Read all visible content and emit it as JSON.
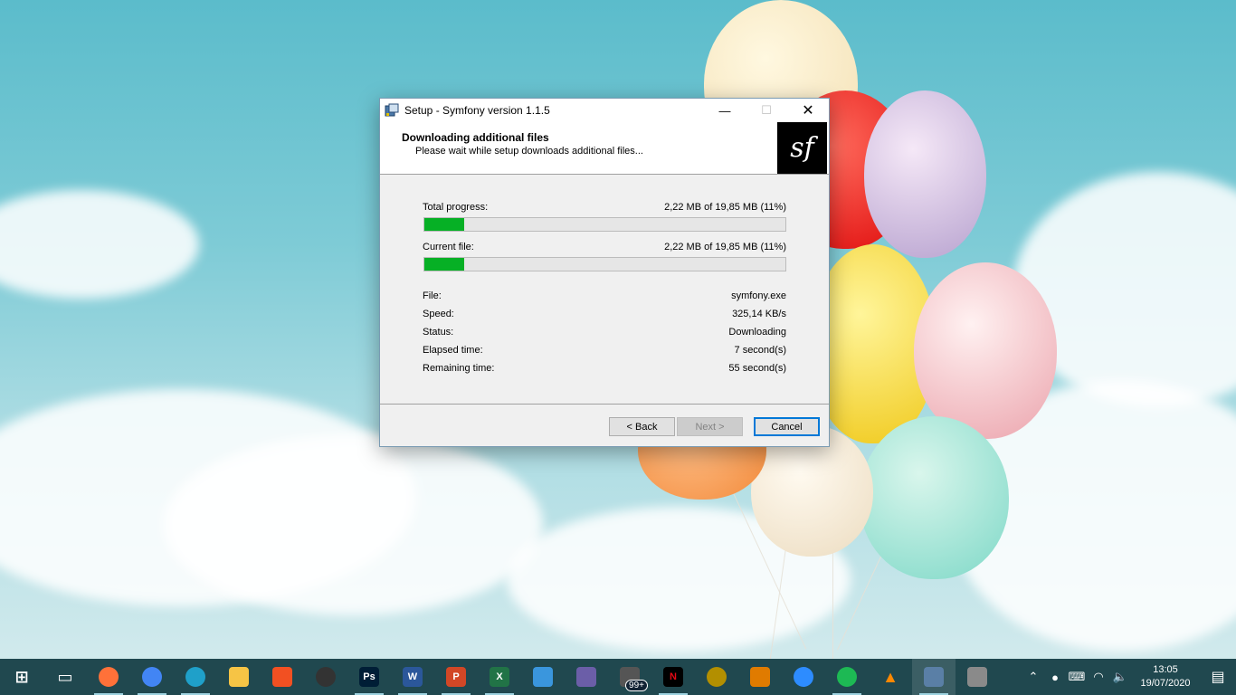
{
  "window": {
    "title": "Setup - Symfony version 1.1.5",
    "minimize_glyph": "—",
    "maximize_glyph": "☐",
    "close_glyph": "✕"
  },
  "header": {
    "title": "Downloading additional files",
    "subtitle": "Please wait while setup downloads additional files...",
    "logo_text": "sf"
  },
  "progress": {
    "total_label": "Total progress:",
    "total_value": "2,22 MB of 19,85 MB (11%)",
    "total_fraction": 0.11,
    "current_label": "Current file:",
    "current_value": "2,22 MB of 19,85 MB (11%)",
    "current_fraction": 0.11
  },
  "details": [
    {
      "label": "File:",
      "value": "symfony.exe"
    },
    {
      "label": "Speed:",
      "value": "325,14 KB/s"
    },
    {
      "label": "Status:",
      "value": "Downloading"
    },
    {
      "label": "Elapsed time:",
      "value": "7 second(s)"
    },
    {
      "label": "Remaining time:",
      "value": "55 second(s)"
    }
  ],
  "buttons": {
    "back": "< Back",
    "next": "Next >",
    "cancel": "Cancel"
  },
  "colors": {
    "progress_fill": "#06b025",
    "taskbar": "#20484f"
  },
  "taskbar": {
    "badge": "99+",
    "items": [
      {
        "name": "start-icon",
        "color": "#ffffff",
        "text": "⊞"
      },
      {
        "name": "task-view-icon",
        "color": "#ffffff",
        "text": "▭"
      },
      {
        "name": "firefox-icon",
        "color": "#ff7139",
        "text": ""
      },
      {
        "name": "chrome-icon",
        "color": "#4285f4",
        "text": ""
      },
      {
        "name": "edge-icon",
        "color": "#1fa0c9",
        "text": ""
      },
      {
        "name": "file-explorer-icon",
        "color": "#f6c445",
        "text": ""
      },
      {
        "name": "store-icon",
        "color": "#f25022",
        "text": ""
      },
      {
        "name": "media-app-icon",
        "color": "#333333",
        "text": ""
      },
      {
        "name": "photoshop-icon",
        "color": "#001e36",
        "text": "Ps"
      },
      {
        "name": "word-icon",
        "color": "#2b579a",
        "text": "W"
      },
      {
        "name": "powerpoint-icon",
        "color": "#d24726",
        "text": "P"
      },
      {
        "name": "excel-icon",
        "color": "#217346",
        "text": "X"
      },
      {
        "name": "snipping-icon",
        "color": "#3a96dd",
        "text": ""
      },
      {
        "name": "paint-app-icon",
        "color": "#6b5ea8",
        "text": ""
      },
      {
        "name": "chat-app-icon",
        "color": "#555555",
        "text": ""
      },
      {
        "name": "netflix-icon",
        "color": "#000000",
        "text": "N"
      },
      {
        "name": "game-icon",
        "color": "#b38f00",
        "text": ""
      },
      {
        "name": "tool-app-icon",
        "color": "#e07b00",
        "text": ""
      },
      {
        "name": "zoom-icon",
        "color": "#2d8cff",
        "text": ""
      },
      {
        "name": "spotify-icon",
        "color": "#1db954",
        "text": ""
      },
      {
        "name": "vlc-icon",
        "color": "#ff8800",
        "text": "▲"
      },
      {
        "name": "setup-app-icon",
        "color": "#5a7fa6",
        "text": ""
      },
      {
        "name": "paint-palette-icon",
        "color": "#8a8a8a",
        "text": ""
      }
    ]
  },
  "tray": {
    "time": "13:05",
    "date": "19/07/2020"
  }
}
